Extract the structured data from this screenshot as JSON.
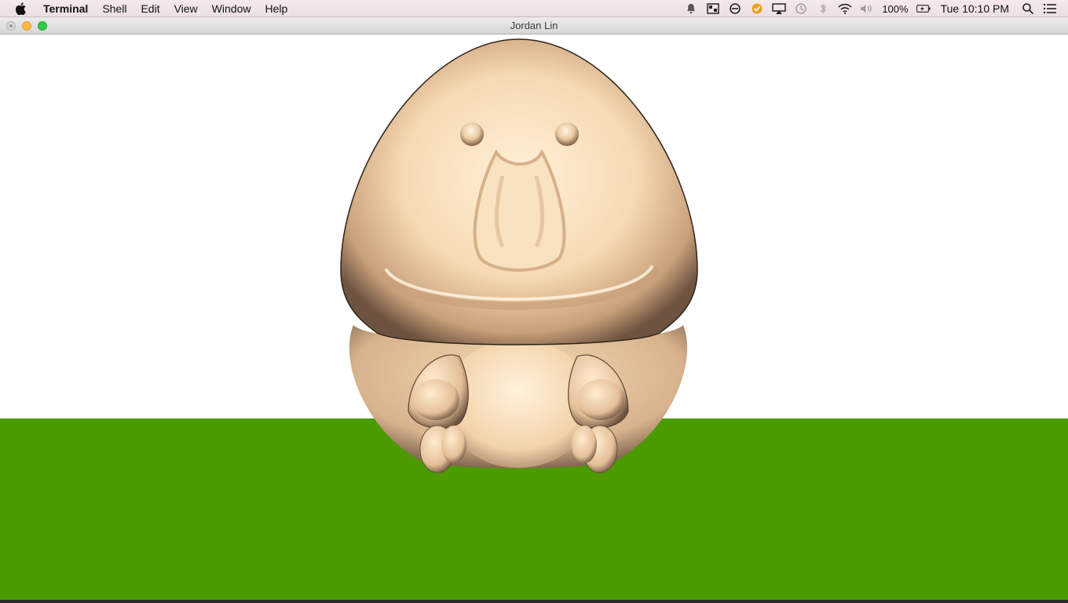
{
  "menubar": {
    "app_name": "Terminal",
    "menus": [
      "Shell",
      "Edit",
      "View",
      "Window",
      "Help"
    ],
    "status": {
      "battery": "100%",
      "clock": "Tue 10:10 PM"
    },
    "icons": [
      "apple-icon",
      "notification-bell-icon",
      "screen-share-icon",
      "sync-icon",
      "task-check-icon",
      "airplay-icon",
      "time-machine-icon",
      "bluetooth-icon",
      "wifi-icon",
      "volume-icon",
      "battery-charging-icon",
      "spotlight-search-icon",
      "notification-center-icon"
    ]
  },
  "window": {
    "title": "Jordan Lin"
  },
  "scene": {
    "background_color": "#ffffff",
    "ground_color": "#4b9a00",
    "model_color": "#f3d3a9"
  }
}
